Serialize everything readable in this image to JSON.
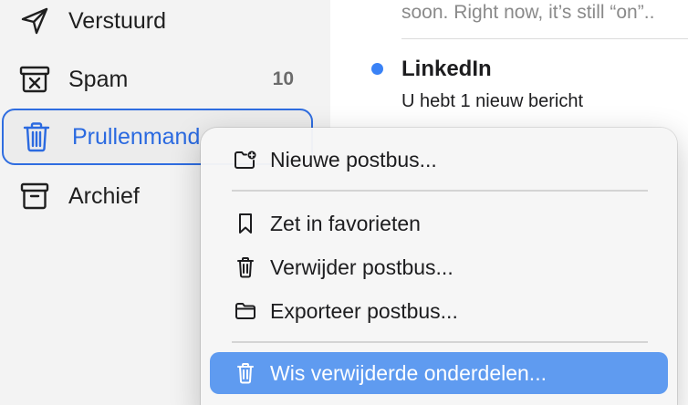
{
  "sidebar": {
    "items": [
      {
        "label": "Verstuurd",
        "icon": "paper-plane-icon"
      },
      {
        "label": "Spam",
        "icon": "junk-icon",
        "count": "10"
      },
      {
        "label": "Prullenmand",
        "icon": "trash-icon",
        "selected": true
      },
      {
        "label": "Archief",
        "icon": "archive-icon"
      }
    ]
  },
  "maillist": {
    "top_snippet": "soon. Right now, it’s still “on”..",
    "message": {
      "sender": "LinkedIn",
      "subject": "U hebt 1 nieuw bericht",
      "unread": true
    }
  },
  "context_menu": {
    "items": [
      {
        "label": "Nieuwe postbus...",
        "icon": "new-folder-icon"
      },
      {
        "label": "Zet in favorieten",
        "icon": "bookmark-icon"
      },
      {
        "label": "Verwijder postbus...",
        "icon": "trash-icon"
      },
      {
        "label": "Exporteer postbus...",
        "icon": "folder-icon"
      },
      {
        "label": "Wis verwijderde onderdelen...",
        "icon": "trash-icon",
        "highlighted": true
      }
    ]
  },
  "colors": {
    "accent": "#2f6de0",
    "unread_dot": "#3a82f6",
    "menu_highlight": "#5f9bf0"
  }
}
